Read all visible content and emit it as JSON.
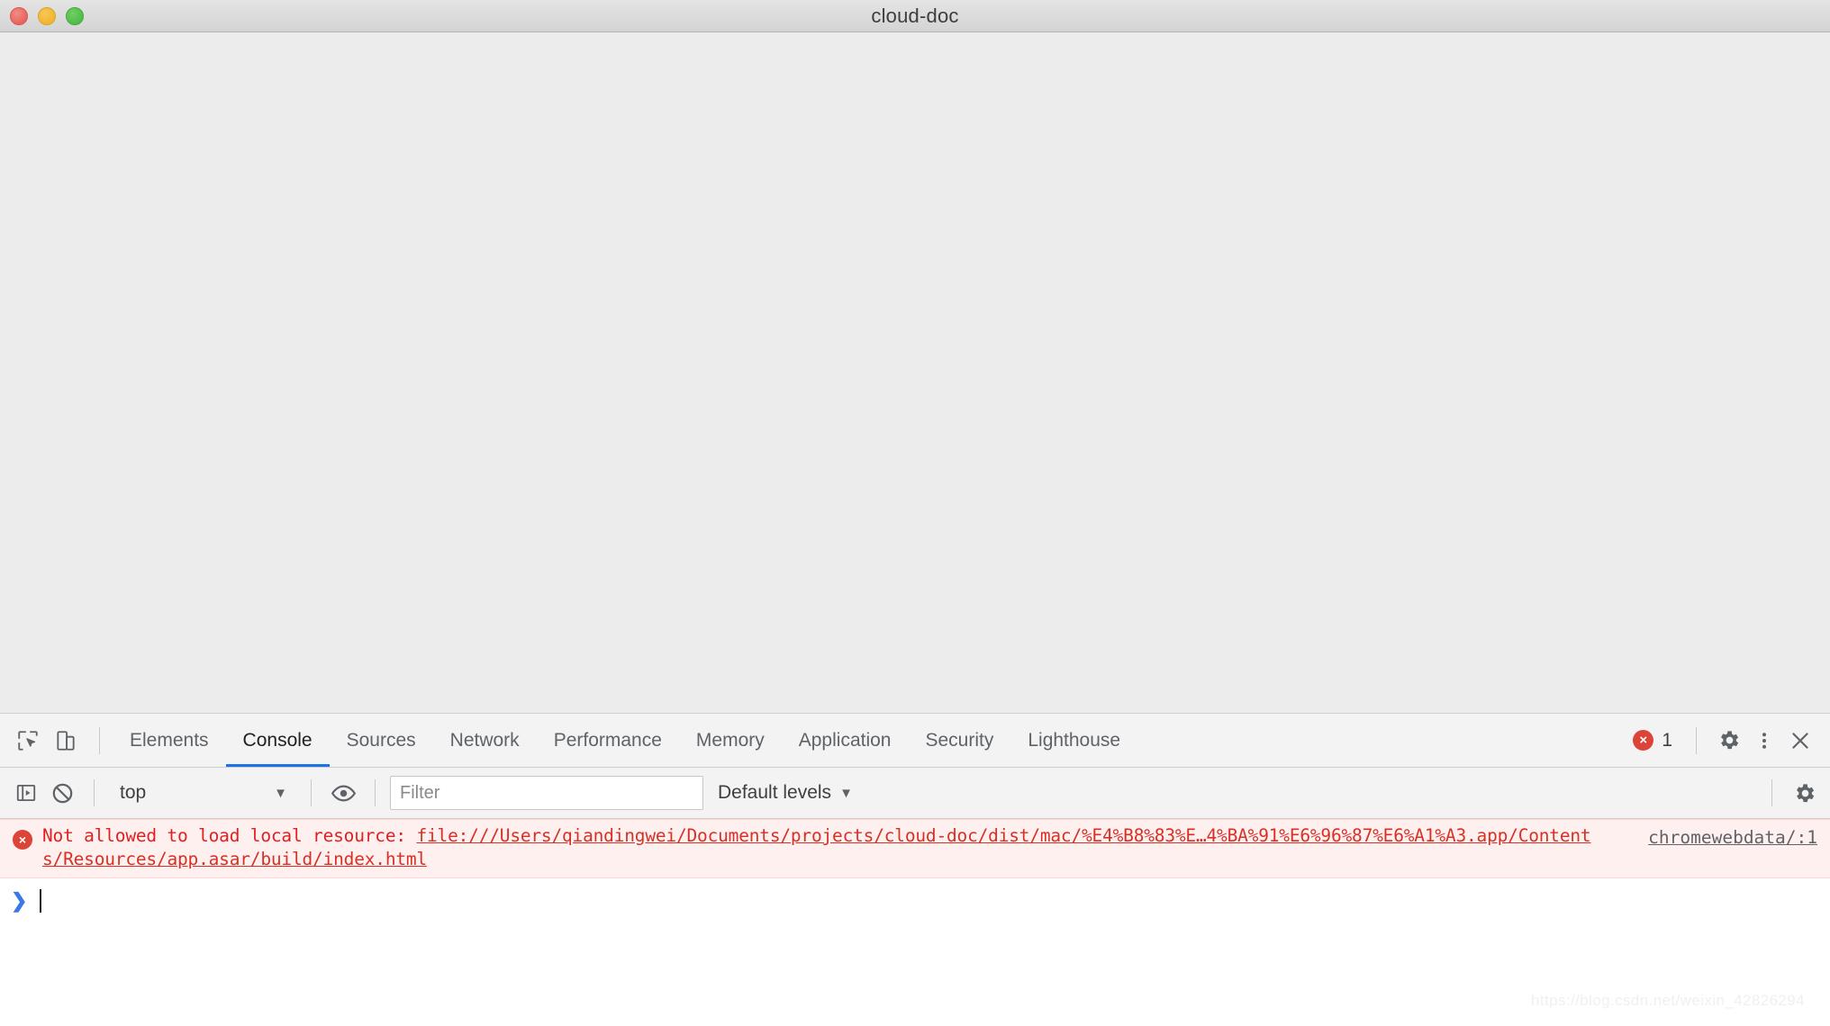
{
  "window": {
    "title": "cloud-doc",
    "traffic_lights": [
      {
        "name": "close",
        "color": "#e9635c"
      },
      {
        "name": "minimize",
        "color": "#f1b52e"
      },
      {
        "name": "maximize",
        "color": "#4ebd45"
      }
    ]
  },
  "viewport": {
    "content": ""
  },
  "devtools": {
    "toolbar_icons": [
      {
        "name": "inspect-element-icon",
        "label": "Inspect element"
      },
      {
        "name": "device-toolbar-icon",
        "label": "Toggle device toolbar"
      }
    ],
    "tabs": [
      {
        "label": "Elements",
        "active": false
      },
      {
        "label": "Console",
        "active": true
      },
      {
        "label": "Sources",
        "active": false
      },
      {
        "label": "Network",
        "active": false
      },
      {
        "label": "Performance",
        "active": false
      },
      {
        "label": "Memory",
        "active": false
      },
      {
        "label": "Application",
        "active": false
      },
      {
        "label": "Security",
        "active": false
      },
      {
        "label": "Lighthouse",
        "active": false
      }
    ],
    "active_tab": "Console",
    "error_badge": {
      "icon_glyph": "×",
      "count": "1"
    },
    "right_icons": [
      {
        "name": "settings-gear-icon",
        "label": "Settings"
      },
      {
        "name": "more-options-icon",
        "label": "Customize and control DevTools"
      },
      {
        "name": "close-devtools-icon",
        "label": "Close DevTools"
      }
    ],
    "accent_color": "#1a73e8",
    "error_color": "#db4437"
  },
  "console_toolbar": {
    "sidebar_toggle": {
      "name": "console-sidebar-icon"
    },
    "clear_console": {
      "name": "clear-console-icon"
    },
    "context": {
      "value": "top",
      "caret": "▼"
    },
    "eye_icon": {
      "name": "live-expression-eye-icon"
    },
    "filter": {
      "placeholder": "Filter",
      "value": ""
    },
    "levels": {
      "label": "Default levels",
      "caret": "▼"
    },
    "settings_gear": {
      "name": "console-settings-gear-icon"
    }
  },
  "console": {
    "messages": [
      {
        "level": "error",
        "icon_glyph": "×",
        "prefix": "Not allowed to load local resource: ",
        "link": "file:///Users/qiandingwei/Documents/projects/cloud-doc/dist/mac/%E4%B8%83%E…4%BA%91%E6%96%87%E6%A1%A3.app/Contents/Resources/app.asar/build/index.html",
        "source": "chromewebdata/:1"
      }
    ],
    "prompt": {
      "caret": "❯",
      "value": ""
    }
  },
  "watermark": "https://blog.csdn.net/weixin_42826294"
}
